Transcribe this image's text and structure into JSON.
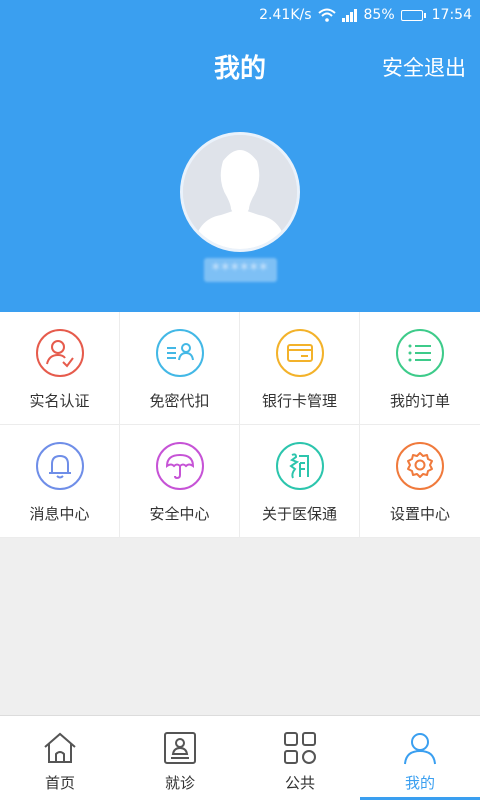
{
  "status_bar": {
    "net_speed": "2.41K/s",
    "battery_percent": "85%",
    "battery_level": 0.85,
    "time": "17:54"
  },
  "header": {
    "title": "我的",
    "logout_label": "安全退出",
    "username": "******"
  },
  "menu": [
    {
      "label": "实名认证",
      "icon": "id-check-icon",
      "color": "#e65b4c"
    },
    {
      "label": "免密代扣",
      "icon": "list-user-icon",
      "color": "#43b8e6"
    },
    {
      "label": "银行卡管理",
      "icon": "bank-card-icon",
      "color": "#f3b22a"
    },
    {
      "label": "我的订单",
      "icon": "order-list-icon",
      "color": "#3ecb8a"
    },
    {
      "label": "消息中心",
      "icon": "bell-icon",
      "color": "#6f8ee8"
    },
    {
      "label": "安全中心",
      "icon": "umbrella-icon",
      "color": "#c653d6"
    },
    {
      "label": "关于医保通",
      "icon": "about-logo-icon",
      "color": "#2cc5ad"
    },
    {
      "label": "设置中心",
      "icon": "gear-icon",
      "color": "#f07a3c"
    }
  ],
  "tabs": [
    {
      "label": "首页",
      "icon": "home-icon",
      "active": false
    },
    {
      "label": "就诊",
      "icon": "medical-card-icon",
      "active": false
    },
    {
      "label": "公共",
      "icon": "grid-icon",
      "active": false
    },
    {
      "label": "我的",
      "icon": "profile-icon",
      "active": true
    }
  ],
  "colors": {
    "primary": "#3a9ff0",
    "background": "#efefef"
  }
}
